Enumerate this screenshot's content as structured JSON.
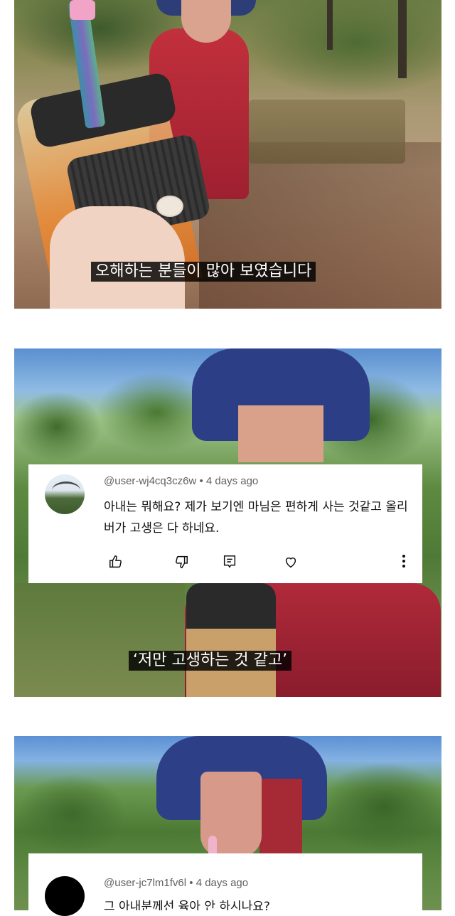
{
  "frame1": {
    "subtitle": "오해하는 분들이 많아 보였습니다"
  },
  "frame2": {
    "comment": {
      "username": "@user-wj4cq3cz6w",
      "separator": "•",
      "time": "4 days ago",
      "text": "아내는 뭐해요? 제가 보기엔 마님은 편하게 사는 것같고 올리버가 고생은 다 하네요."
    },
    "subtitle": "‘저만 고생하는 것 같고’"
  },
  "frame3": {
    "comment": {
      "username": "@user-jc7lm1fv6l",
      "separator": "•",
      "time": "4 days ago",
      "text": "그 아내분께선 육아 안 하시나요?"
    }
  },
  "icons": {
    "like": "thumbs-up-icon",
    "dislike": "thumbs-down-icon",
    "reply": "reply-icon",
    "heart": "heart-icon",
    "more": "more-vertical-icon"
  },
  "colors": {
    "subtitle_bg": "#000000",
    "subtitle_text": "#ffffff",
    "meta_text": "#606060",
    "hat_blue": "#2c3f86",
    "shirt_red": "#b02a3a"
  }
}
